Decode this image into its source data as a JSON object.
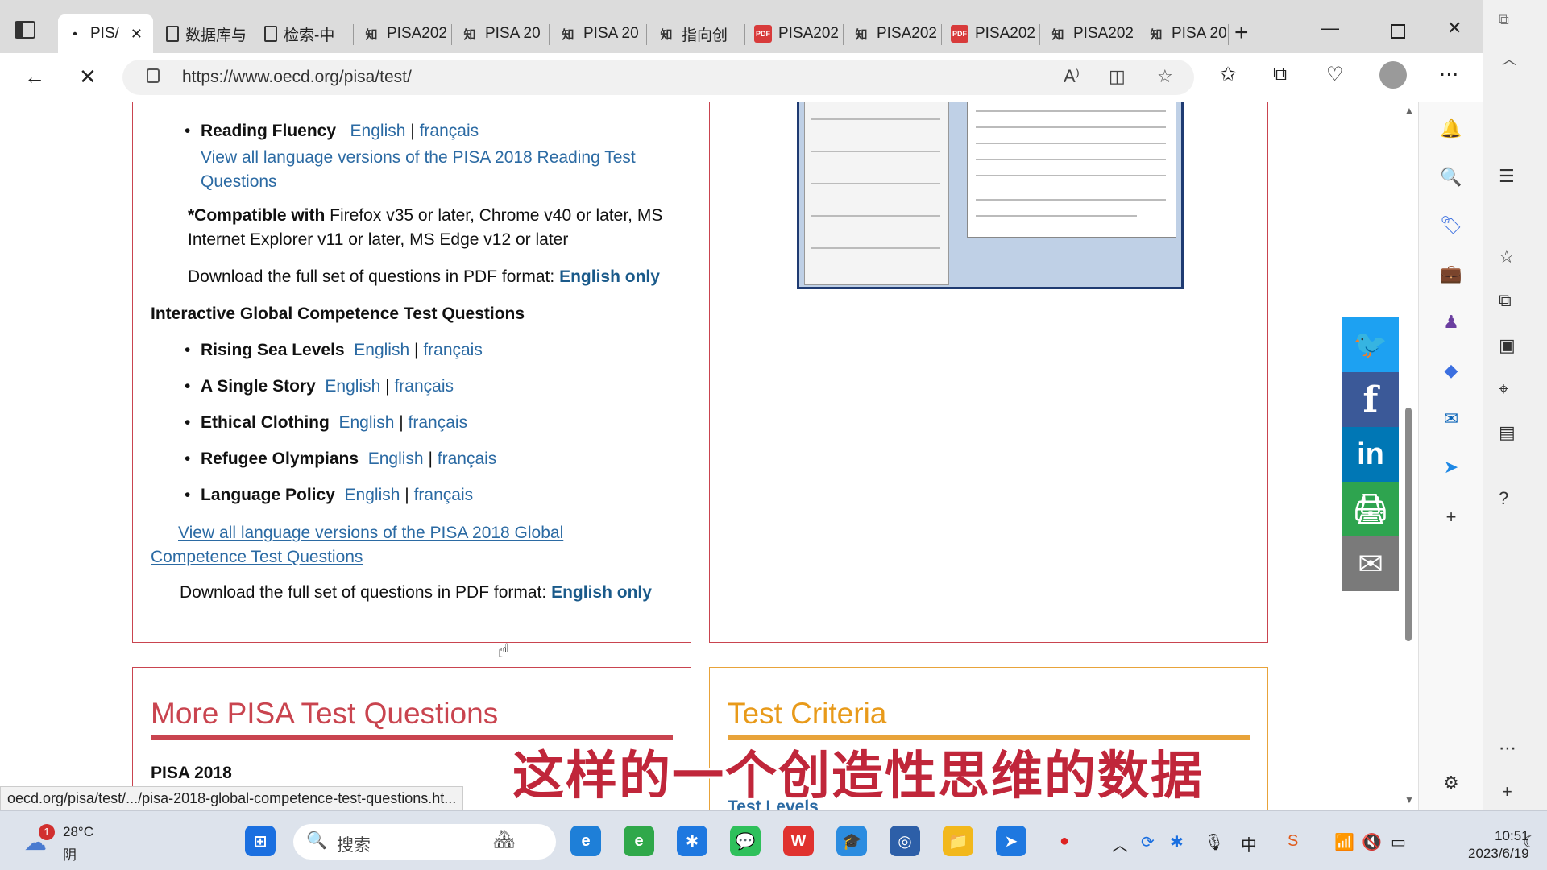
{
  "browser": {
    "tabs": [
      {
        "label": "PIS/",
        "icon": "spinner",
        "active": true
      },
      {
        "label": "数据库与",
        "icon": "doc"
      },
      {
        "label": "检索-中",
        "icon": "doc"
      },
      {
        "label": "PISA202",
        "icon": "zhi"
      },
      {
        "label": "PISA 20",
        "icon": "zhi"
      },
      {
        "label": "PISA 20",
        "icon": "zhi"
      },
      {
        "label": "指向创",
        "icon": "zhi"
      },
      {
        "label": "PISA202",
        "icon": "pdf"
      },
      {
        "label": "PISA202",
        "icon": "zhi"
      },
      {
        "label": "PISA202",
        "icon": "pdf"
      },
      {
        "label": "PISA202",
        "icon": "zhi"
      },
      {
        "label": "PISA 20",
        "icon": "zhi"
      }
    ],
    "url": "https://www.oecd.org/pisa/test/"
  },
  "reading": {
    "item_title": "Reading Fluency",
    "english": "English",
    "sep": "|",
    "french": "français",
    "view_all": "View all language versions of the PISA 2018 Reading Test Questions",
    "compat_bold": "*Compatible with",
    "compat_rest": " Firefox v35 or later, Chrome v40 or later, MS Internet Explorer v11 or later, MS Edge v12 or later",
    "download_text": "Download the full set of questions in PDF format:",
    "download_link": "English only"
  },
  "global": {
    "heading": "Interactive Global Competence Test Questions",
    "items": [
      {
        "title": "Rising Sea Levels",
        "english": "English",
        "french": "français"
      },
      {
        "title": "A Single Story",
        "english": "English",
        "french": "français"
      },
      {
        "title": "Ethical Clothing",
        "english": "English",
        "french": "français"
      },
      {
        "title": "Refugee Olympians",
        "english": "English",
        "french": "français"
      },
      {
        "title": "Language Policy",
        "english": "English",
        "french": "français"
      }
    ],
    "view_all": "View all language versions of the PISA 2018 Global Competence Test Questions",
    "download_text": "Download the full set of questions in PDF format:",
    "download_link": "English only"
  },
  "sections": {
    "more_title": "More PISA Test Questions",
    "more_sub": "PISA 2018",
    "criteria_title": "Test Criteria",
    "criteria_link": "Test Levels",
    "more_color": "#c9444f",
    "criteria_color": "#e8a33a"
  },
  "status_url": "oecd.org/pisa/test/.../pisa-2018-global-competence-test-questions.ht...",
  "caption": "这样的一个创造性思维的数据",
  "share": [
    {
      "name": "twitter",
      "glyph": "🐦",
      "color": "#1da1f2"
    },
    {
      "name": "facebook",
      "glyph": "f",
      "color": "#3b5998"
    },
    {
      "name": "linkedin",
      "glyph": "in",
      "color": "#0077b5"
    },
    {
      "name": "print",
      "glyph": "🖨",
      "color": "#2ea44f"
    },
    {
      "name": "email",
      "glyph": "✉",
      "color": "#7a7a7a"
    }
  ],
  "taskbar": {
    "weather_temp": "28°C",
    "weather_cond": "阴",
    "weather_badge": "1",
    "search": "搜索",
    "ime": "中",
    "time": "10:51",
    "date": "2023/6/19"
  }
}
